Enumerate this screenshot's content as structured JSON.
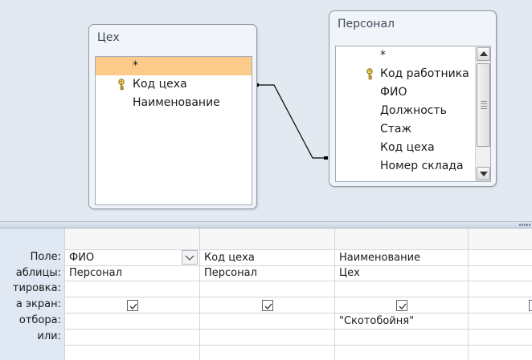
{
  "tables": {
    "tseh": {
      "title": "Цех",
      "fields": [
        "*",
        "Код цеха",
        "Наименование"
      ]
    },
    "personal": {
      "title": "Персонал",
      "fields": [
        "*",
        "Код работника",
        "ФИО",
        "Должность",
        "Стаж",
        "Код цеха",
        "Номер склада"
      ]
    }
  },
  "grid": {
    "row_labels": {
      "field": "Поле:",
      "table": "аблицы:",
      "sort": "тировка:",
      "show": "а экран:",
      "criteria": "отбора:",
      "or": "или:"
    },
    "columns": [
      {
        "field": "ФИО",
        "table": "Персонал",
        "sort": "",
        "show": true,
        "criteria": "",
        "or": ""
      },
      {
        "field": "Код цеха",
        "table": "Персонал",
        "sort": "",
        "show": true,
        "criteria": "",
        "or": ""
      },
      {
        "field": "Наименование",
        "table": "Цех",
        "sort": "",
        "show": true,
        "criteria": "\"Скотобойня\"",
        "or": ""
      },
      {
        "field": "",
        "table": "",
        "sort": "",
        "show": false,
        "criteria": "",
        "or": ""
      }
    ]
  },
  "colors": {
    "pane_bg": "#e3e9f1",
    "selected_field": "#fccb8a",
    "row_label_bg": "#dfe8f3"
  },
  "icons": [
    "key-icon",
    "scroll-up-icon",
    "scroll-down-icon",
    "dropdown-arrow-icon",
    "checkbox-checked-icon"
  ]
}
